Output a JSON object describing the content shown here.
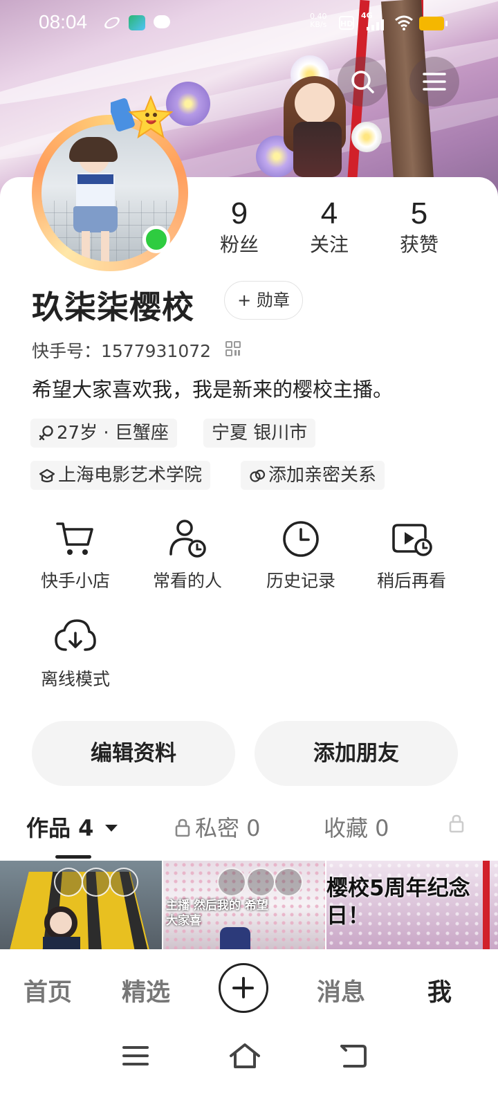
{
  "status_bar": {
    "time": "08:04",
    "net_speed": "0.40",
    "net_unit": "KB/s",
    "hd": "HD",
    "signal": "4G",
    "colors": {
      "battery": "#f5b700"
    }
  },
  "header": {
    "search_icon": "search-icon",
    "menu_icon": "menu-icon"
  },
  "profile": {
    "stats": [
      {
        "value": "9",
        "label": "粉丝"
      },
      {
        "value": "4",
        "label": "关注"
      },
      {
        "value": "5",
        "label": "获赞"
      }
    ],
    "name": "玖柒柒樱校",
    "medal_button": "+ 勋章",
    "kuaishou_id": "快手号：1577931072",
    "bio": "希望大家喜欢我，我是新来的樱校主播。",
    "tags": [
      {
        "text": "27岁 · 巨蟹座",
        "icon": "female-icon"
      },
      {
        "text": "宁夏 银川市",
        "icon": ""
      },
      {
        "text": "上海电影艺术学院",
        "icon": "school-icon"
      },
      {
        "text": "添加亲密关系",
        "icon": "relation-icon"
      }
    ],
    "online_color": "#2ecc40"
  },
  "tools": [
    {
      "label": "快手小店",
      "icon": "cart-icon"
    },
    {
      "label": "常看的人",
      "icon": "user-clock-icon"
    },
    {
      "label": "历史记录",
      "icon": "clock-icon"
    },
    {
      "label": "稍后再看",
      "icon": "watch-later-icon"
    },
    {
      "label": "离线模式",
      "icon": "cloud-download-icon"
    }
  ],
  "actions": {
    "edit_profile": "编辑资料",
    "add_friend": "添加朋友"
  },
  "tabs": [
    {
      "label": "作品 4",
      "active": true
    },
    {
      "label": "私密 0",
      "locked": true
    },
    {
      "label": "收藏 0"
    },
    {
      "label": "",
      "locked": true
    }
  ],
  "thumbnails": [
    {
      "caption": ""
    },
    {
      "caption": "主播 然后我的 希望大家喜"
    },
    {
      "caption": "樱校5周年纪念日！"
    }
  ],
  "bottom_nav": {
    "home": "首页",
    "featured": "精选",
    "messages": "消息",
    "me": "我"
  }
}
